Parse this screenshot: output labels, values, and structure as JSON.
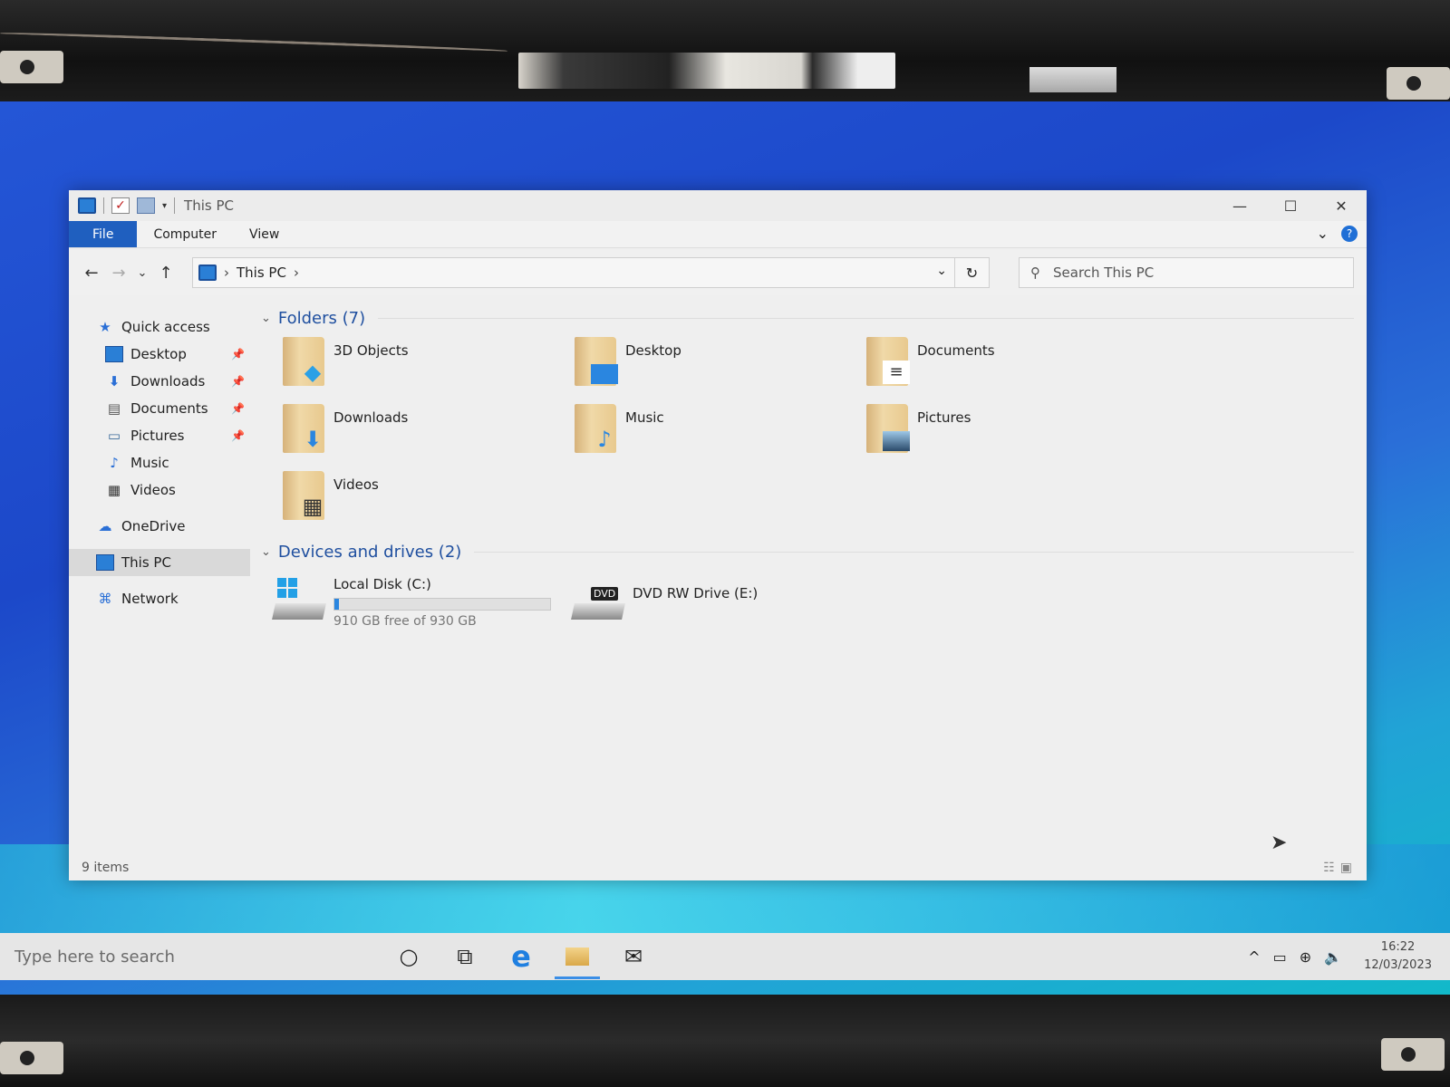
{
  "window": {
    "title": "This PC",
    "controls": {
      "minimize": "—",
      "maximize": "☐",
      "close": "✕"
    }
  },
  "ribbon": {
    "tabs": [
      "File",
      "Computer",
      "View"
    ],
    "collapse": "⌄",
    "help": "?"
  },
  "nav": {
    "back": "←",
    "forward": "→",
    "recent": "⌄",
    "up": "↑",
    "address": {
      "chev1": "›",
      "location": "This PC",
      "chev2": "›",
      "dropdown": "⌄",
      "refresh": "↻"
    },
    "search": {
      "icon": "⚲",
      "placeholder": "Search This PC"
    }
  },
  "sidebar": {
    "quick_access": {
      "label": "Quick access",
      "icon": "star-icon"
    },
    "items": [
      {
        "label": "Desktop",
        "icon": "desktop-icon",
        "pinned": true
      },
      {
        "label": "Downloads",
        "icon": "downloads-icon",
        "pinned": true
      },
      {
        "label": "Documents",
        "icon": "documents-icon",
        "pinned": true
      },
      {
        "label": "Pictures",
        "icon": "pictures-icon",
        "pinned": true
      },
      {
        "label": "Music",
        "icon": "music-icon",
        "pinned": false
      },
      {
        "label": "Videos",
        "icon": "videos-icon",
        "pinned": false
      }
    ],
    "onedrive": "OneDrive",
    "this_pc": "This PC",
    "network": "Network"
  },
  "content": {
    "folders_header": "Folders (7)",
    "folders": [
      {
        "label": "3D Objects",
        "icon": "3d-objects-icon"
      },
      {
        "label": "Desktop",
        "icon": "desktop-folder-icon"
      },
      {
        "label": "Documents",
        "icon": "documents-folder-icon"
      },
      {
        "label": "Downloads",
        "icon": "downloads-folder-icon"
      },
      {
        "label": "Music",
        "icon": "music-folder-icon"
      },
      {
        "label": "Pictures",
        "icon": "pictures-folder-icon"
      },
      {
        "label": "Videos",
        "icon": "videos-folder-icon"
      }
    ],
    "drives_header": "Devices and drives (2)",
    "drives": [
      {
        "label": "Local Disk (C:)",
        "free_text": "910 GB free of 930 GB",
        "used_fraction": 0.0215
      },
      {
        "label": "DVD RW Drive (E:)",
        "badge": "DVD"
      }
    ]
  },
  "status": {
    "items": "9 items"
  },
  "taskbar": {
    "search_placeholder": "Type here to search",
    "time": "16:22",
    "date": "12/03/2023"
  }
}
